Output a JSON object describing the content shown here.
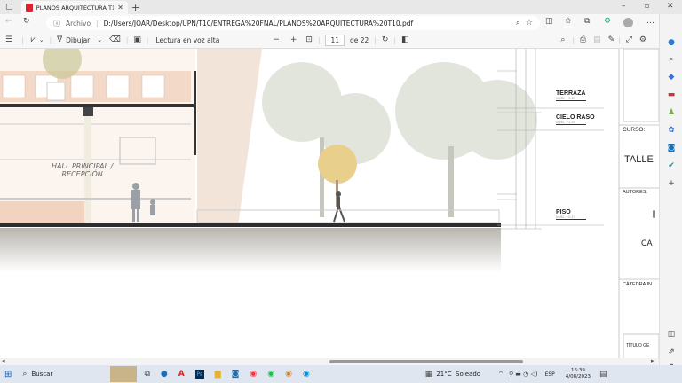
{
  "browser": {
    "tab_title": "PLANOS ARQUITECTURA T10.pdf",
    "address_prefix": "Archivo",
    "url": "D:/Users/JOAR/Desktop/UPN/T10/ENTREGA%20FNAL/PLANOS%20ARQUITECTURA%20T10.pdf"
  },
  "pdf_toolbar": {
    "draw_label": "Dibujar",
    "read_aloud_label": "Lectura en voz alta",
    "page_current": "11",
    "page_total": "de 22"
  },
  "drawing": {
    "hall_label_1": "HALL PRINCIPAL /",
    "hall_label_2": "RECEPCIÓN",
    "levels": [
      {
        "name": "TERRAZA",
        "value": "NIVEL +3.05"
      },
      {
        "name": "CIELO RASO",
        "value": "NIVEL +2.95"
      },
      {
        "name": "PISO",
        "value": "NIVEL +0.15"
      }
    ],
    "title_block": {
      "curso_label": "CURSO:",
      "curso_value": "TALLE",
      "autores_label": "AUTORES:",
      "autor_value": "CA",
      "catedra_label": "CÁTEDRA IN",
      "titulo_label": "TÍTULO GE"
    }
  },
  "taskbar": {
    "search_label": "Buscar",
    "weather": "21°C  Soleado",
    "language": "ESP",
    "time": "16:39",
    "date": "4/08/2023"
  }
}
